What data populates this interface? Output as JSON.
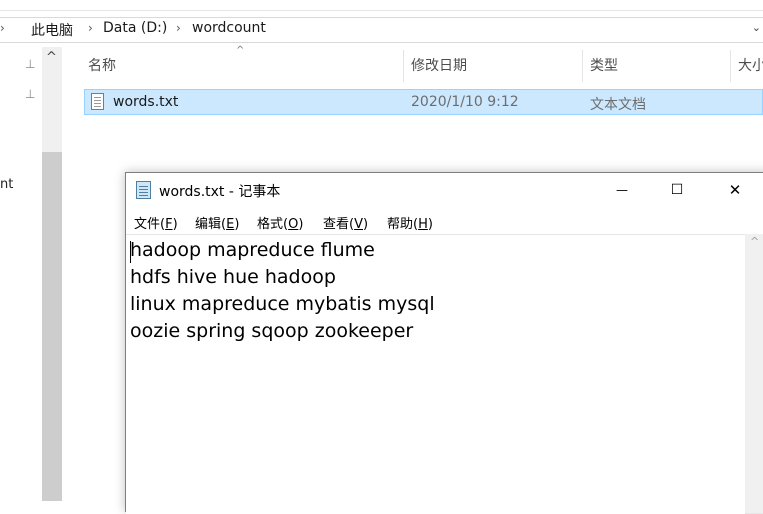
{
  "explorer": {
    "breadcrumb": [
      "此电脑",
      "Data (D:)",
      "wordcount"
    ],
    "columns": [
      "名称",
      "修改日期",
      "类型",
      "大小"
    ],
    "nav_partial_text": "nt",
    "file": {
      "name": "words.txt",
      "modified": "2020/1/10 9:12",
      "type": "文本文档"
    }
  },
  "notepad": {
    "title": "words.txt - 记事本",
    "menu": [
      {
        "label": "文件",
        "key": "F"
      },
      {
        "label": "编辑",
        "key": "E"
      },
      {
        "label": "格式",
        "key": "O"
      },
      {
        "label": "查看",
        "key": "V"
      },
      {
        "label": "帮助",
        "key": "H"
      }
    ],
    "lines": [
      "hadoop mapreduce flume",
      "hdfs hive hue hadoop",
      "linux mapreduce mybatis mysql",
      "oozie spring sqoop zookeeper"
    ],
    "controls": {
      "minimize": "—",
      "maximize": "☐",
      "close": "✕"
    }
  },
  "icons": {
    "chevron": "›",
    "pin": "📌",
    "dropdown": "⌄",
    "scroll_up": "^"
  }
}
